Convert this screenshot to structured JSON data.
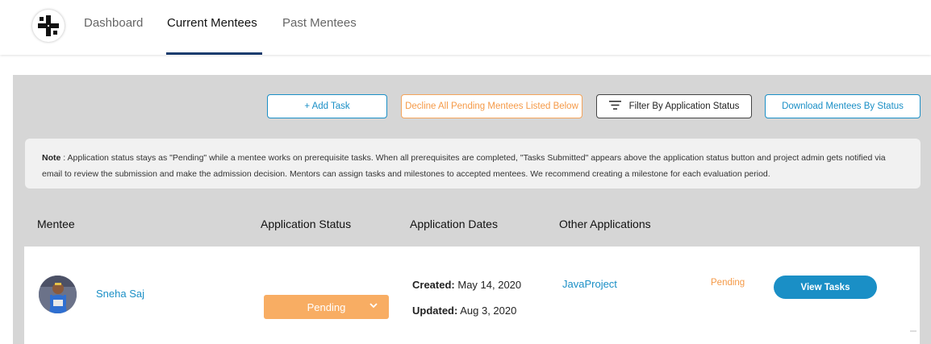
{
  "nav": {
    "tabs": [
      {
        "label": "Dashboard"
      },
      {
        "label": "Current Mentees",
        "active": true
      },
      {
        "label": "Past Mentees"
      }
    ],
    "logo_icon": "cross-logo-icon"
  },
  "actions": {
    "add_task": "+ Add Task",
    "decline_all": "Decline All Pending Mentees Listed Below",
    "filter": "Filter By Application Status",
    "download": "Download Mentees By Status",
    "filter_icon": "filter-lines-icon"
  },
  "note": {
    "label": "Note",
    "text": " : Application status stays as \"Pending\" while a mentee works on prerequisite tasks. When all prerequisites are completed, \"Tasks Submitted\" appears above the application status button and project admin gets notified via email to review the submission and make the admission decision. Mentors can assign tasks and milestones to accepted mentees. We recommend creating a milestone for each evaluation period."
  },
  "table": {
    "headers": {
      "mentee": "Mentee",
      "application_status": "Application Status",
      "application_dates": "Application Dates",
      "other_applications": "Other Applications"
    },
    "rows": [
      {
        "name": "Sneha Saj",
        "status": "Pending",
        "created_label": "Created:",
        "created": " May 14, 2020",
        "updated_label": "Updated:",
        "updated": " Aug 3, 2020",
        "other_project": "JavaProject",
        "other_status": "Pending",
        "view_tasks": "View Tasks"
      }
    ]
  },
  "colors": {
    "accent": "#1a8fc6",
    "pending": "#f8ad63",
    "nav_active": "#1a3c6e"
  }
}
